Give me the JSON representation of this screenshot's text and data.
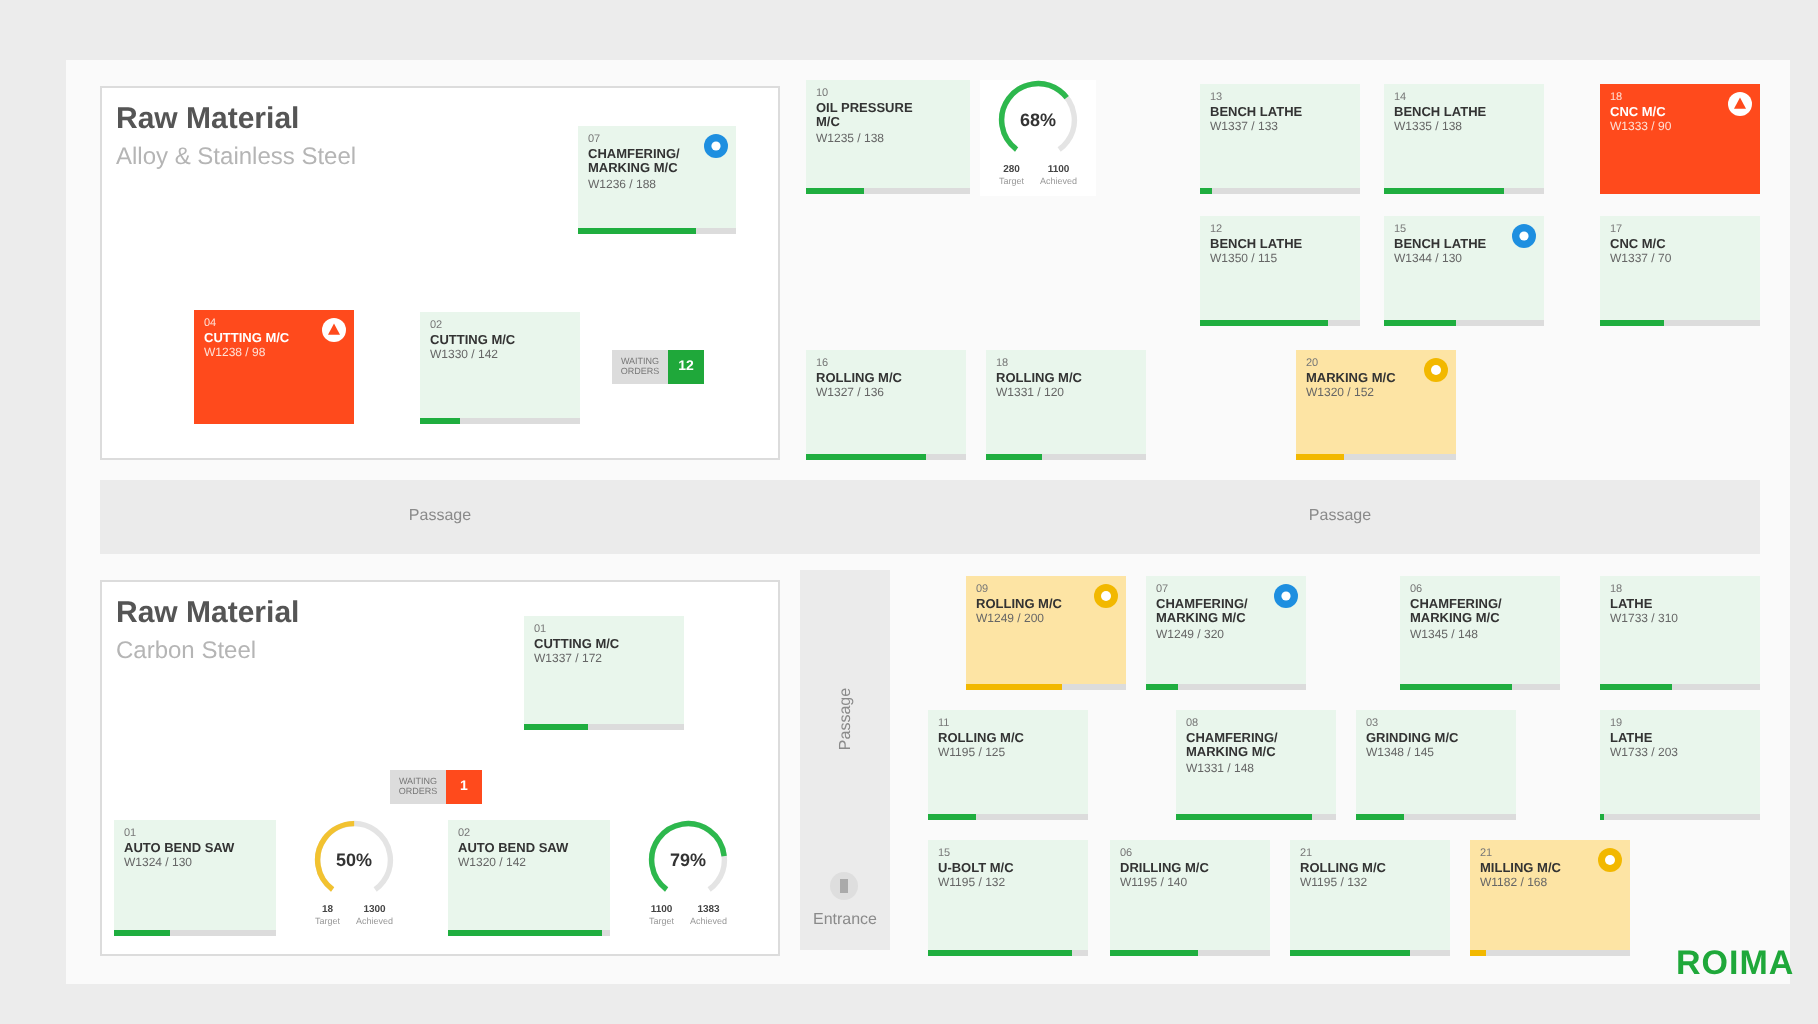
{
  "zones": [
    {
      "title": "Raw Material",
      "subtitle": "Alloy & Stainless Steel"
    },
    {
      "title": "Raw Material",
      "subtitle": "Carbon Steel"
    }
  ],
  "passages": [
    {
      "label": "Passage"
    },
    {
      "label": "Passage"
    },
    {
      "label": "Passage"
    }
  ],
  "entrance": {
    "label": "Entrance"
  },
  "machines": [
    {
      "code": "07",
      "name": "CHAMFERING/ MARKING M/C",
      "weight": "W1236 / 188",
      "kind": "normal",
      "flagged": true,
      "level": 0.75
    },
    {
      "code": "04",
      "name": "CUTTING M/C",
      "weight": "W1238 / 98",
      "kind": "alert",
      "flagged": true
    },
    {
      "code": "02",
      "name": "CUTTING M/C",
      "weight": "W1330 / 142",
      "kind": "normal",
      "flagged": false,
      "level": 0.25
    },
    {
      "code": "10",
      "name": "OIL PRESSURE M/C",
      "weight": "W1235 / 138",
      "kind": "normal",
      "flagged": false,
      "level": 0.35
    },
    {
      "code": "16",
      "name": "ROLLING M/C",
      "weight": "W1327 / 136",
      "kind": "normal",
      "flagged": false,
      "level": 0.75
    },
    {
      "code": "18",
      "name": "ROLLING M/C",
      "weight": "W1331 / 120",
      "kind": "normal",
      "flagged": false,
      "level": 0.35
    },
    {
      "code": "13",
      "name": "BENCH LATHE",
      "weight": "W1337 / 133",
      "kind": "normal",
      "flagged": false,
      "level": 0.08
    },
    {
      "code": "14",
      "name": "BENCH LATHE",
      "weight": "W1335 / 138",
      "kind": "normal",
      "flagged": false,
      "level": 0.75
    },
    {
      "code": "18",
      "name": "CNC M/C",
      "weight": "W1333 / 90",
      "kind": "alert",
      "flagged": true
    },
    {
      "code": "12",
      "name": "BENCH LATHE",
      "weight": "W1350 / 115",
      "kind": "normal",
      "flagged": false,
      "level": 0.8
    },
    {
      "code": "15",
      "name": "BENCH LATHE",
      "weight": "W1344 / 130",
      "kind": "normal",
      "flagged": true,
      "level": 0.45
    },
    {
      "code": "17",
      "name": "CNC M/C",
      "weight": "W1337 / 70",
      "kind": "normal",
      "flagged": false,
      "level": 0.4
    },
    {
      "code": "20",
      "name": "MARKING M/C",
      "weight": "W1320 / 152",
      "kind": "warning",
      "flagged": true,
      "level": 0.3
    },
    {
      "code": "01",
      "name": "CUTTING M/C",
      "weight": "W1337 / 172",
      "kind": "normal",
      "flagged": false,
      "level": 0.4
    },
    {
      "code": "01",
      "name": "AUTO BEND SAW",
      "weight": "W1324 / 130",
      "kind": "normal",
      "flagged": false,
      "level": 0.35
    },
    {
      "code": "02",
      "name": "AUTO BEND SAW",
      "weight": "W1320 / 142",
      "kind": "normal",
      "flagged": false,
      "level": 0.95
    },
    {
      "code": "09",
      "name": "ROLLING M/C",
      "weight": "W1249 / 200",
      "kind": "warning",
      "flagged": true,
      "level": 0.6
    },
    {
      "code": "07",
      "name": "CHAMFERING/ MARKING M/C",
      "weight": "W1249 / 320",
      "kind": "normal",
      "flagged": true,
      "level": 0.2
    },
    {
      "code": "06",
      "name": "CHAMFERING/ MARKING M/C",
      "weight": "W1345 / 148",
      "kind": "normal",
      "flagged": false,
      "level": 0.7
    },
    {
      "code": "18",
      "name": "LATHE",
      "weight": "W1733 / 310",
      "kind": "normal",
      "flagged": false,
      "level": 0.45
    },
    {
      "code": "11",
      "name": "ROLLING M/C",
      "weight": "W1195 / 125",
      "kind": "normal",
      "flagged": false,
      "level": 0.3
    },
    {
      "code": "08",
      "name": "CHAMFERING/ MARKING M/C",
      "weight": "W1331 / 148",
      "kind": "normal",
      "flagged": false,
      "level": 0.85
    },
    {
      "code": "03",
      "name": "GRINDING M/C",
      "weight": "W1348 / 145",
      "kind": "normal",
      "flagged": false,
      "level": 0.3
    },
    {
      "code": "19",
      "name": "LATHE",
      "weight": "W1733 / 203",
      "kind": "normal",
      "flagged": false,
      "level": 0.03
    },
    {
      "code": "15",
      "name": "U-BOLT M/C",
      "weight": "W1195 / 132",
      "kind": "normal",
      "flagged": false,
      "level": 0.9
    },
    {
      "code": "06",
      "name": "DRILLING M/C",
      "weight": "W1195 / 140",
      "kind": "normal",
      "flagged": false,
      "level": 0.55
    },
    {
      "code": "21",
      "name": "ROLLING M/C",
      "weight": "W1195 / 132",
      "kind": "normal",
      "flagged": false,
      "level": 0.75
    },
    {
      "code": "21",
      "name": "MILLING M/C",
      "weight": "W1182 / 168",
      "kind": "warning",
      "flagged": true,
      "level": 0.1
    }
  ],
  "gauges": [
    {
      "percent": "68%",
      "level": 0.68,
      "color": "#2db84d",
      "stats": [
        {
          "value": "280",
          "label": "Target"
        },
        {
          "value": "1100",
          "label": "Achieved"
        }
      ]
    },
    {
      "percent": "50%",
      "level": 0.5,
      "color": "#f2c230",
      "stats": [
        {
          "value": "18",
          "label": "Target"
        },
        {
          "value": "1300",
          "label": "Achieved"
        }
      ]
    },
    {
      "percent": "79%",
      "level": 0.79,
      "color": "#2db84d",
      "stats": [
        {
          "value": "1100",
          "label": "Target"
        },
        {
          "value": "1383",
          "label": "Achieved"
        }
      ]
    }
  ],
  "queues": [
    {
      "label": "WAITING ORDERS",
      "count": "12",
      "color": "#1fa83a"
    },
    {
      "label": "WAITING ORDERS",
      "count": "1",
      "color": "#ff4a1c"
    }
  ],
  "logo": "ROIMA"
}
